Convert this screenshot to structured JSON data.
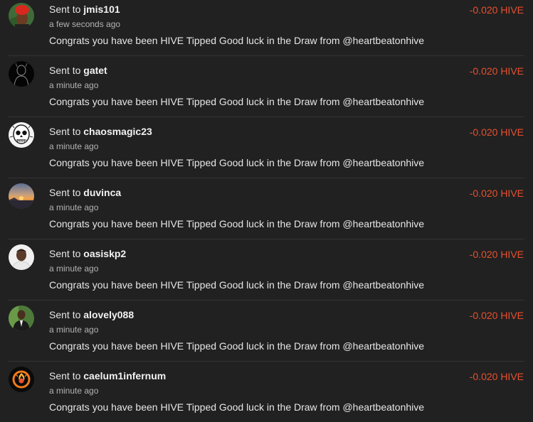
{
  "colors": {
    "background": "#212121",
    "divider": "#343434",
    "amount": "#e8502f",
    "text": "#e6e6e6",
    "muted": "#b3b3b3"
  },
  "transfers": [
    {
      "sent_label": "Sent to",
      "username": "jmis101",
      "time": "a few seconds ago",
      "memo": "Congrats you have been HIVE Tipped Good luck in the Draw from @heartbeatonhive",
      "amount": "-0.020 HIVE",
      "avatar_icon": "avatar-red-headwrap-icon"
    },
    {
      "sent_label": "Sent to",
      "username": "gatet",
      "time": "a minute ago",
      "memo": "Congrats you have been HIVE Tipped Good luck in the Draw from @heartbeatonhive",
      "amount": "-0.020 HIVE",
      "avatar_icon": "avatar-silhouette-icon"
    },
    {
      "sent_label": "Sent to",
      "username": "chaosmagic23",
      "time": "a minute ago",
      "memo": "Congrats you have been HIVE Tipped Good luck in the Draw from @heartbeatonhive",
      "amount": "-0.020 HIVE",
      "avatar_icon": "avatar-skull-drawing-icon"
    },
    {
      "sent_label": "Sent to",
      "username": "duvinca",
      "time": "a minute ago",
      "memo": "Congrats you have been HIVE Tipped Good luck in the Draw from @heartbeatonhive",
      "amount": "-0.020 HIVE",
      "avatar_icon": "avatar-sunset-icon"
    },
    {
      "sent_label": "Sent to",
      "username": "oasiskp2",
      "time": "a minute ago",
      "memo": "Congrats you have been HIVE Tipped Good luck in the Draw from @heartbeatonhive",
      "amount": "-0.020 HIVE",
      "avatar_icon": "avatar-man-portrait-icon"
    },
    {
      "sent_label": "Sent to",
      "username": "alovely088",
      "time": "a minute ago",
      "memo": "Congrats you have been HIVE Tipped Good luck in the Draw from @heartbeatonhive",
      "amount": "-0.020 HIVE",
      "avatar_icon": "avatar-man-suit-icon"
    },
    {
      "sent_label": "Sent to",
      "username": "caelum1infernum",
      "time": "a minute ago",
      "memo": "Congrats you have been HIVE Tipped Good luck in the Draw from @heartbeatonhive",
      "amount": "-0.020 HIVE",
      "avatar_icon": "avatar-fire-logo-icon"
    }
  ]
}
